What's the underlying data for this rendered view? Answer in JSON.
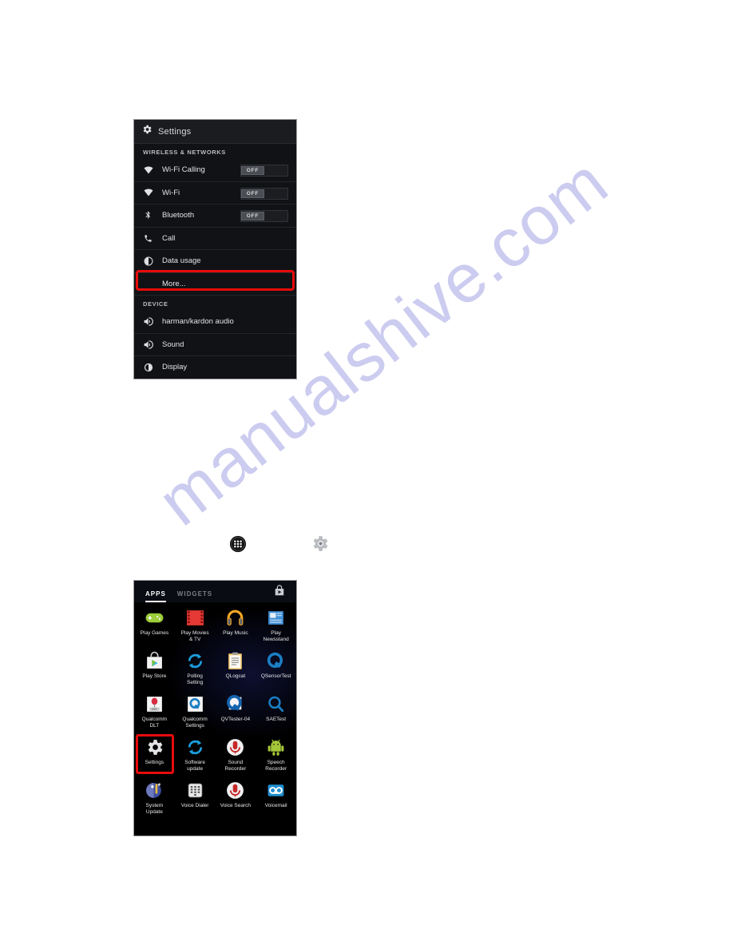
{
  "watermark": {
    "text": "manualshive.com"
  },
  "settings_screen": {
    "header": {
      "title": "Settings",
      "icon": "gear-icon"
    },
    "sections": [
      {
        "label": "WIRELESS & NETWORKS",
        "rows": [
          {
            "label": "Wi-Fi Calling",
            "icon": "wifi-icon",
            "toggle": "OFF"
          },
          {
            "label": "Wi-Fi",
            "icon": "wifi-icon",
            "toggle": "OFF"
          },
          {
            "label": "Bluetooth",
            "icon": "bluetooth-icon",
            "toggle": "OFF"
          },
          {
            "label": "Call",
            "icon": "phone-icon",
            "toggle": null
          },
          {
            "label": "Data usage",
            "icon": "data-usage-icon",
            "toggle": null
          },
          {
            "label": "More...",
            "icon": null,
            "toggle": null,
            "highlighted": true
          }
        ]
      },
      {
        "label": "DEVICE",
        "rows": [
          {
            "label": "harman/kardon audio",
            "icon": "speaker-icon",
            "toggle": null
          },
          {
            "label": "Sound",
            "icon": "speaker-icon",
            "toggle": null
          },
          {
            "label": "Display",
            "icon": "brightness-icon",
            "toggle": null
          }
        ]
      }
    ]
  },
  "middle_icons": [
    {
      "name": "apps-drawer-icon",
      "label": "Apps drawer"
    },
    {
      "name": "settings-gear-icon",
      "label": "Settings"
    }
  ],
  "app_drawer": {
    "tabs": [
      {
        "label": "APPS",
        "active": true
      },
      {
        "label": "WIDGETS",
        "active": false
      }
    ],
    "store_icon": "play-store-icon",
    "apps": [
      {
        "label": "Play Games",
        "icon": "play-games-icon"
      },
      {
        "label": "Play Movies\n& TV",
        "icon": "play-movies-icon"
      },
      {
        "label": "Play Music",
        "icon": "play-music-icon"
      },
      {
        "label": "Play\nNewsstand",
        "icon": "play-newsstand-icon"
      },
      {
        "label": "Play Store",
        "icon": "play-store-icon"
      },
      {
        "label": "Polling\nSetting",
        "icon": "polling-setting-icon"
      },
      {
        "label": "QLogcat",
        "icon": "qlogcat-icon"
      },
      {
        "label": "QSensorTest",
        "icon": "qsensortest-icon"
      },
      {
        "label": "Qualcomm\nDLT",
        "icon": "qualcomm-dlt-icon"
      },
      {
        "label": "Qualcomm\nSettings",
        "icon": "qualcomm-settings-icon"
      },
      {
        "label": "QVTester-04",
        "icon": "qvtester-icon"
      },
      {
        "label": "SAETest",
        "icon": "saetest-icon"
      },
      {
        "label": "Settings",
        "icon": "settings-gear-icon",
        "highlighted": true
      },
      {
        "label": "Software\nupdate",
        "icon": "software-update-icon"
      },
      {
        "label": "Sound\nRecorder",
        "icon": "sound-recorder-icon"
      },
      {
        "label": "Speech\nRecorder",
        "icon": "speech-recorder-icon"
      },
      {
        "label": "System\nUpdate",
        "icon": "system-update-icon"
      },
      {
        "label": "Voice Dialer",
        "icon": "voice-dialer-icon"
      },
      {
        "label": "Voice Search",
        "icon": "voice-search-icon"
      },
      {
        "label": "Voicemail",
        "icon": "voicemail-icon"
      }
    ]
  },
  "colors": {
    "highlight_red": "#e80b0b",
    "watermark": "#ccccf0",
    "panel_bg": "#111215"
  }
}
